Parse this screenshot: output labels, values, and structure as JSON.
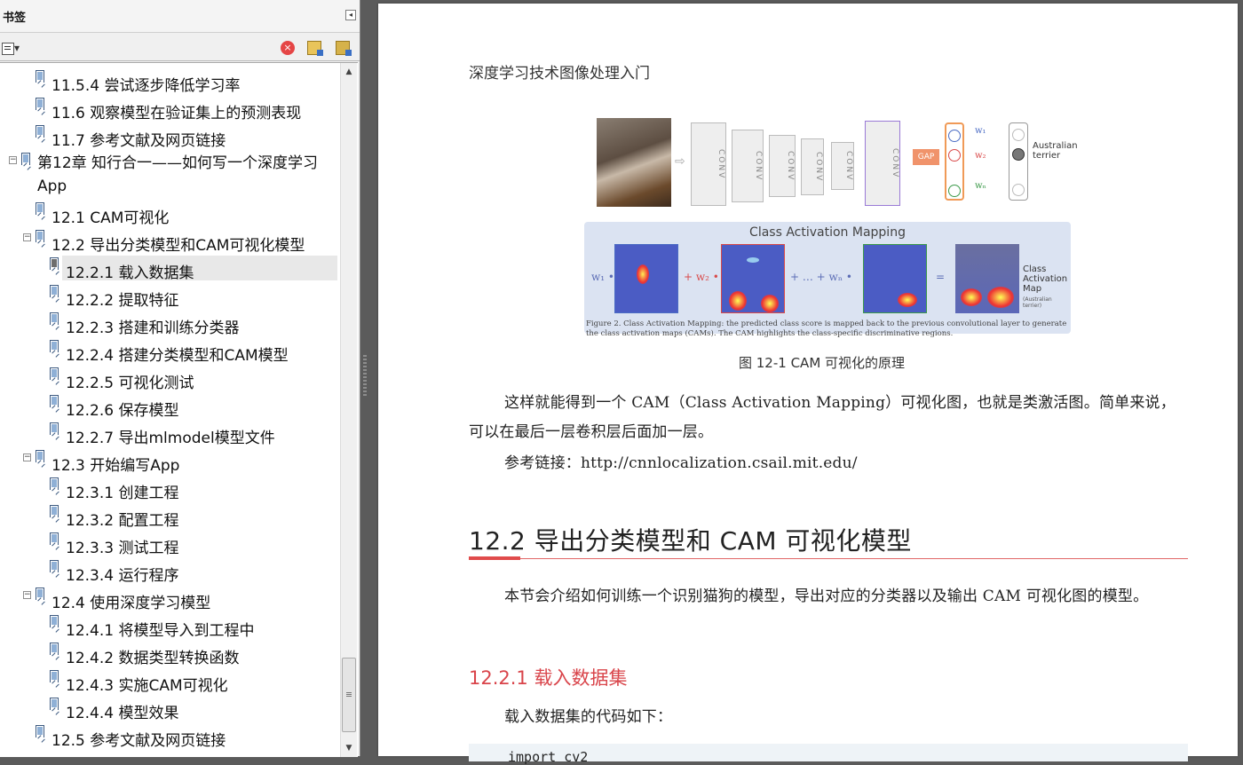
{
  "bookmarks_panel": {
    "title": "书签",
    "collapse_icon": "◂",
    "items": [
      {
        "label": "11.5.4 尝试逐步降低学习率",
        "level": 2,
        "toggle": ""
      },
      {
        "label": "11.6 观察模型在验证集上的预测表现",
        "level": 2,
        "toggle": ""
      },
      {
        "label": "11.7 参考文献及网页链接",
        "level": 2,
        "toggle": ""
      },
      {
        "label": "第12章 知行合一——如何写一个深度学习App",
        "level": 1,
        "toggle": "−"
      },
      {
        "label": "12.1 CAM可视化",
        "level": 2,
        "toggle": ""
      },
      {
        "label": "12.2 导出分类模型和CAM可视化模型",
        "level": 2,
        "toggle": "−"
      },
      {
        "label": "12.2.1 载入数据集",
        "level": 3,
        "toggle": "",
        "selected": true
      },
      {
        "label": "12.2.2 提取特征",
        "level": 3,
        "toggle": ""
      },
      {
        "label": "12.2.3 搭建和训练分类器",
        "level": 3,
        "toggle": ""
      },
      {
        "label": "12.2.4 搭建分类模型和CAM模型",
        "level": 3,
        "toggle": ""
      },
      {
        "label": "12.2.5 可视化测试",
        "level": 3,
        "toggle": ""
      },
      {
        "label": "12.2.6 保存模型",
        "level": 3,
        "toggle": ""
      },
      {
        "label": "12.2.7 导出mlmodel模型文件",
        "level": 3,
        "toggle": ""
      },
      {
        "label": "12.3 开始编写App",
        "level": 2,
        "toggle": "−"
      },
      {
        "label": "12.3.1 创建工程",
        "level": 3,
        "toggle": ""
      },
      {
        "label": "12.3.2 配置工程",
        "level": 3,
        "toggle": ""
      },
      {
        "label": "12.3.3 测试工程",
        "level": 3,
        "toggle": ""
      },
      {
        "label": "12.3.4 运行程序",
        "level": 3,
        "toggle": ""
      },
      {
        "label": "12.4 使用深度学习模型",
        "level": 2,
        "toggle": "−"
      },
      {
        "label": "12.4.1 将模型导入到工程中",
        "level": 3,
        "toggle": ""
      },
      {
        "label": "12.4.2 数据类型转换函数",
        "level": 3,
        "toggle": ""
      },
      {
        "label": "12.4.3 实施CAM可视化",
        "level": 3,
        "toggle": ""
      },
      {
        "label": "12.4.4 模型效果",
        "level": 3,
        "toggle": ""
      },
      {
        "label": "12.5 参考文献及网页链接",
        "level": 2,
        "toggle": ""
      }
    ],
    "scroll_up": "▲",
    "scroll_down": "▼",
    "delete_glyph": "×"
  },
  "document": {
    "running_header": "深度学习技术图像处理入门",
    "figure": {
      "conv_label": "CONV",
      "gap_label": "GAP",
      "w1": "w₁",
      "w2": "w₂",
      "wn": "wₙ",
      "class_label": "Australian terrier",
      "banner_title": "Class Activation Mapping",
      "op_w1": "w₁ •",
      "op_w2": "+ w₂ •",
      "op_dots": "+ … + wₙ •",
      "op_eq": "=",
      "side_label": "Class Activation Map",
      "side_sub": "(Australian terrier)",
      "caption_en": "Figure 2. Class Activation Mapping: the predicted class score is mapped back to the previous convolutional layer to generate the class activation maps (CAMs). The CAM highlights the class-specific discriminative regions.",
      "caption_cn": "图 12-1  CAM 可视化的原理"
    },
    "paragraph_1": "这样就能得到一个 CAM（Class Activation Mapping）可视化图，也就是类激活图。简单来说，可以在最后一层卷积层后面加一层。",
    "paragraph_2": "参考链接：http://cnnlocalization.csail.mit.edu/",
    "h2": "12.2  导出分类模型和 CAM 可视化模型",
    "paragraph_3": "本节会介绍如何训练一个识别猫狗的模型，导出对应的分类器以及输出 CAM 可视化图的模型。",
    "h3": "12.2.1  载入数据集",
    "paragraph_4": "载入数据集的代码如下：",
    "code_first_line": "import cv2"
  }
}
